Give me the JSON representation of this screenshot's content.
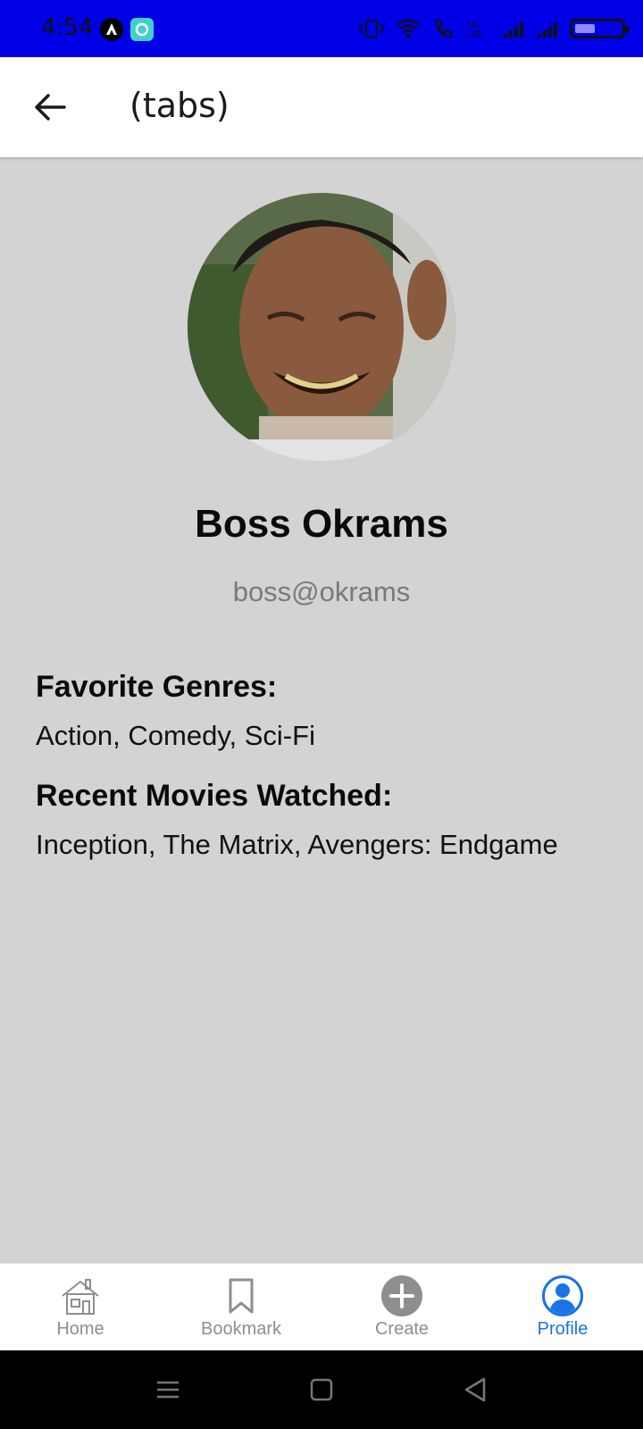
{
  "status_bar": {
    "time": "4:54",
    "background": "#0000e6"
  },
  "header": {
    "title": "(tabs)",
    "back_icon": "arrow-left-icon"
  },
  "profile": {
    "name": "Boss Okrams",
    "email": "boss@okrams",
    "avatar": "profile-photo"
  },
  "sections": [
    {
      "label": "Favorite Genres:",
      "value": "Action, Comedy, Sci-Fi"
    },
    {
      "label": "Recent Movies Watched:",
      "value": "Inception, The Matrix, Avengers: Endgame"
    }
  ],
  "tabs": [
    {
      "label": "Home",
      "icon": "home-icon",
      "active": false
    },
    {
      "label": "Bookmark",
      "icon": "bookmark-icon",
      "active": false
    },
    {
      "label": "Create",
      "icon": "plus-circle-icon",
      "active": false
    },
    {
      "label": "Profile",
      "icon": "user-circle-icon",
      "active": true
    }
  ],
  "colors": {
    "accent": "#1a73e8",
    "background": "#d3d3d3",
    "inactive": "#8e8e8e"
  }
}
